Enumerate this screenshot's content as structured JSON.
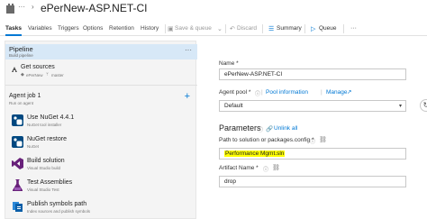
{
  "header": {
    "ellipsis": "···",
    "separator": "›",
    "title": "ePerNew-ASP.NET-CI"
  },
  "tabs": [
    {
      "label": "Tasks",
      "active": true
    },
    {
      "label": "Variables"
    },
    {
      "label": "Triggers"
    },
    {
      "label": "Options"
    },
    {
      "label": "Retention"
    },
    {
      "label": "History"
    }
  ],
  "toolbar": {
    "save_queue": "Save & queue",
    "discard": "Discard",
    "summary": "Summary",
    "queue": "Queue"
  },
  "left": {
    "pipeline": {
      "title": "Pipeline",
      "subtitle": "Build pipeline",
      "more": "···"
    },
    "get_sources": {
      "title": "Get sources",
      "repo": "ePerNew",
      "branch": "master"
    },
    "agent_job": {
      "title": "Agent job 1",
      "subtitle": "Run on agent",
      "add": "+"
    },
    "tasks": [
      {
        "title": "Use NuGet 4.4.1",
        "subtitle": "NuGet tool installer"
      },
      {
        "title": "NuGet restore",
        "subtitle": "NuGet"
      },
      {
        "title": "Build solution",
        "subtitle": "Visual Studio build"
      },
      {
        "title": "Test Assemblies",
        "subtitle": "Visual Studio Test"
      },
      {
        "title": "Publish symbols path",
        "subtitle": "Index sources and publish symbols"
      }
    ]
  },
  "right": {
    "name_label": "Name *",
    "name_value": "ePerNew-ASP.NET-CI",
    "agent_pool_label": "Agent pool *",
    "pool_information": "Pool information",
    "manage": "Manage",
    "agent_pool_value": "Default",
    "parameters_heading": "Parameters",
    "unlink_all": "Unlink all",
    "solution_label": "Path to solution or packages.config *",
    "solution_value": "Performance Mgmt.sln",
    "artifact_label": "Artifact Name *",
    "artifact_value": "drop"
  },
  "colors": {
    "accent": "#0078d4",
    "selected_bg": "#d7e8f7",
    "highlight": "#ffff00"
  }
}
